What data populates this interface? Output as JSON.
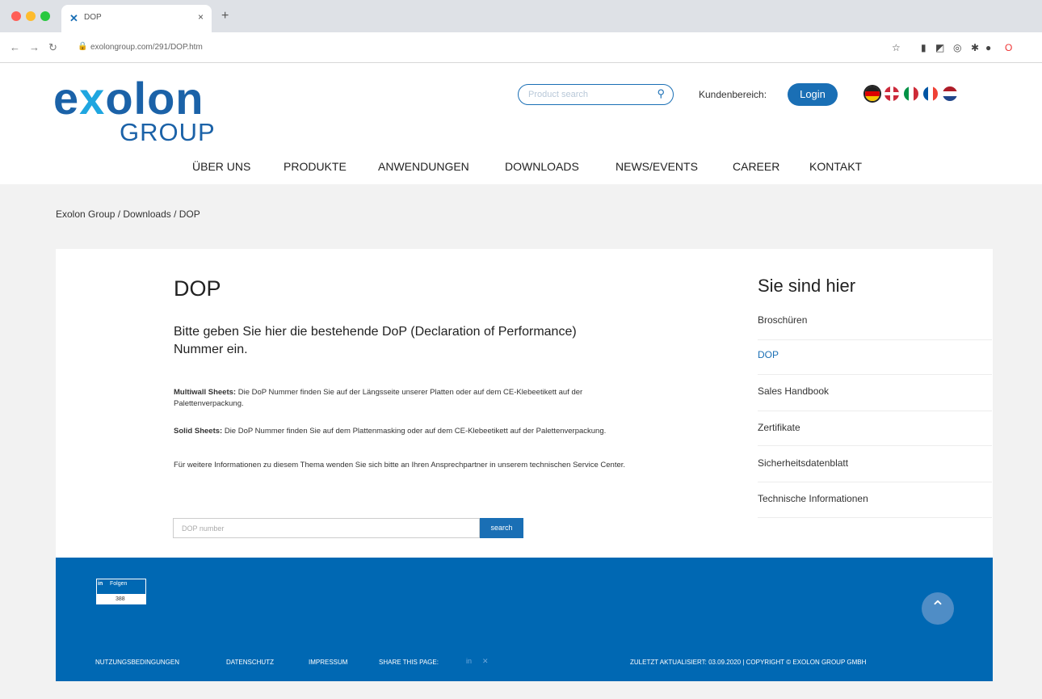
{
  "browser": {
    "tab_title": "DOP",
    "tab_close": "×",
    "new_tab": "+",
    "url": "exolongroup.com/291/DOP.htm"
  },
  "header": {
    "logo_exolon": "exolon",
    "logo_group": "GROUP",
    "search_placeholder": "Product search",
    "kunden_label": "Kundenbereich:",
    "login_label": "Login",
    "flags": [
      "de",
      "gb",
      "it",
      "fr",
      "nl"
    ]
  },
  "nav": [
    "ÜBER UNS",
    "PRODUKTE",
    "ANWENDUNGEN",
    "DOWNLOADS",
    "NEWS/EVENTS",
    "CAREER",
    "KONTAKT"
  ],
  "breadcrumb": "Exolon Group  /  Downloads  /  DOP",
  "main": {
    "title": "DOP",
    "intro": "Bitte geben Sie hier die bestehende DoP (Declaration of Performance) Nummer ein.",
    "p1_label": "Multiwall Sheets:",
    "p1_text": " Die DoP Nummer finden Sie auf der Längsseite unserer Platten oder auf dem CE-Klebeetikett auf der Palettenverpackung.",
    "p2_label": "Solid Sheets:",
    "p2_text": " Die DoP Nummer finden Sie auf dem Plattenmasking oder auf dem CE-Klebeetikett auf der Palettenverpackung.",
    "p3": "Für weitere Informationen zu diesem Thema wenden Sie sich bitte an Ihren Ansprechpartner in unserem technischen Service Center.",
    "dop_placeholder": "DOP number",
    "search_button": "search"
  },
  "sidebar": {
    "title": "Sie sind hier",
    "items": [
      {
        "label": "Broschüren",
        "active": false
      },
      {
        "label": "DOP",
        "active": true
      },
      {
        "label": "Sales Handbook",
        "active": false
      },
      {
        "label": "Zertifikate",
        "active": false
      },
      {
        "label": "Sicherheitsdatenblatt",
        "active": false
      },
      {
        "label": "Technische Informationen",
        "active": false
      }
    ]
  },
  "footer": {
    "linkedin_logo": "in",
    "linkedin_label": "Folgen",
    "linkedin_count": "388",
    "links": [
      "NUTZUNGSBEDINGUNGEN",
      "DATENSCHUTZ",
      "IMPRESSUM"
    ],
    "share_label": "SHARE THIS PAGE:",
    "updated_copyright": "ZULETZT AKTUALISIERT: 03.09.2020  |  COPYRIGHT © EXOLON GROUP GMBH"
  },
  "colors": {
    "brand_blue": "#1a6fb5",
    "footer_blue": "#0068b3",
    "page_grey": "#f2f2f2"
  }
}
